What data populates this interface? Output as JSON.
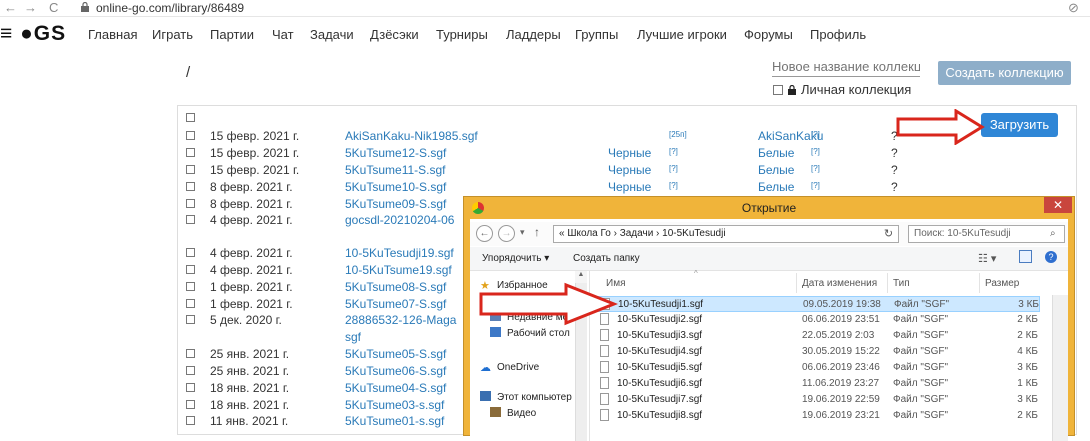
{
  "browser": {
    "back": "←",
    "forward": "→",
    "reload": "C",
    "url": "online-go.com/library/86489",
    "eye": "⊘"
  },
  "site": {
    "logo": "≡ ●GS",
    "nav": [
      "Главная",
      "Играть",
      "Партии",
      "Чат",
      "Задачи",
      "Дзёсэки",
      "Турниры",
      "Ладдеры",
      "Группы",
      "Лучшие игроки",
      "Форумы",
      "Профиль"
    ]
  },
  "library": {
    "path": "/",
    "new_collection_placeholder": "Новое название коллекции",
    "private_collection_label": "Личная коллекция",
    "create_collection_button": "Создать коллекцию",
    "upload_button": "Загрузить",
    "rows": [
      {
        "date": "15 февр. 2021 г.",
        "file": "AkiSanKaku-Nik1985.sgf",
        "black": "",
        "q1": "[25п]",
        "white": "AkiSanKaku",
        "q2": "[?]",
        "result": "?"
      },
      {
        "date": "15 февр. 2021 г.",
        "file": "5KuTsume12-S.sgf",
        "black": "Черные",
        "q1": "[?]",
        "white": "Белые",
        "q2": "[?]",
        "result": "?"
      },
      {
        "date": "15 февр. 2021 г.",
        "file": "5KuTsume11-S.sgf",
        "black": "Черные",
        "q1": "[?]",
        "white": "Белые",
        "q2": "[?]",
        "result": "?"
      },
      {
        "date": "8 февр. 2021 г.",
        "file": "5KuTsume10-S.sgf",
        "black": "Черные",
        "q1": "[?]",
        "white": "Белые",
        "q2": "[?]",
        "result": "?"
      },
      {
        "date": "8 февр. 2021 г.",
        "file": "5KuTsume09-S.sgf",
        "black": "",
        "q1": "",
        "white": "",
        "q2": "",
        "result": ""
      },
      {
        "date": "4 февр. 2021 г.",
        "file": "gocsdl-20210204-06",
        "black": "",
        "q1": "",
        "white": "",
        "q2": "",
        "result": ""
      },
      {
        "date": "4 февр. 2021 г.",
        "file": "10-5KuTesudji19.sgf",
        "black": "",
        "q1": "",
        "white": "",
        "q2": "",
        "result": ""
      },
      {
        "date": "4 февр. 2021 г.",
        "file": "10-5KuTsume19.sgf",
        "black": "",
        "q1": "",
        "white": "",
        "q2": "",
        "result": ""
      },
      {
        "date": "1 февр. 2021 г.",
        "file": "5KuTsume08-S.sgf",
        "black": "",
        "q1": "",
        "white": "",
        "q2": "",
        "result": ""
      },
      {
        "date": "1 февр. 2021 г.",
        "file": "5KuTsume07-S.sgf",
        "black": "",
        "q1": "",
        "white": "",
        "q2": "",
        "result": ""
      },
      {
        "date": "5 дек. 2020 г.",
        "file": "28886532-126-Maga",
        "black": "",
        "q1": "",
        "white": "",
        "q2": "",
        "result": ""
      },
      {
        "date": "",
        "file": "sgf",
        "black": "",
        "q1": "",
        "white": "",
        "q2": "",
        "result": ""
      },
      {
        "date": "25 янв. 2021 г.",
        "file": "5KuTsume05-S.sgf",
        "black": "",
        "q1": "",
        "white": "",
        "q2": "",
        "result": ""
      },
      {
        "date": "25 янв. 2021 г.",
        "file": "5KuTsume06-S.sgf",
        "black": "",
        "q1": "",
        "white": "",
        "q2": "",
        "result": ""
      },
      {
        "date": "18 янв. 2021 г.",
        "file": "5KuTsume04-S.sgf",
        "black": "",
        "q1": "",
        "white": "",
        "q2": "",
        "result": ""
      },
      {
        "date": "18 янв. 2021 г.",
        "file": "5KuTsume03-s.sgf",
        "black": "",
        "q1": "",
        "white": "",
        "q2": "",
        "result": ""
      },
      {
        "date": "11 янв. 2021 г.",
        "file": "5KuTsume01-s.sgf",
        "black": "",
        "q1": "",
        "white": "",
        "q2": "",
        "result": ""
      }
    ]
  },
  "dialog": {
    "title": "Открытие",
    "close": "✕",
    "path": "« Школа Го › Задачи › 10-5KuTesudji",
    "search_placeholder": "Поиск: 10-5KuTesudji",
    "organize": "Упорядочить ▾",
    "new_folder": "Создать папку",
    "sidebar": [
      "Избранное",
      "Недавние места",
      "Рабочий стол",
      "OneDrive",
      "Этот компьютер",
      "Видео"
    ],
    "columns": {
      "name": "Имя",
      "date": "Дата изменения",
      "type": "Тип",
      "size": "Размер"
    },
    "files": [
      {
        "name": "10-5KuTesudji1.sgf",
        "date": "09.05.2019 19:38",
        "type": "Файл \"SGF\"",
        "size": "3 КБ"
      },
      {
        "name": "10-5KuTesudji2.sgf",
        "date": "06.06.2019 23:51",
        "type": "Файл \"SGF\"",
        "size": "2 КБ"
      },
      {
        "name": "10-5KuTesudji3.sgf",
        "date": "22.05.2019 2:03",
        "type": "Файл \"SGF\"",
        "size": "2 КБ"
      },
      {
        "name": "10-5KuTesudji4.sgf",
        "date": "30.05.2019 15:22",
        "type": "Файл \"SGF\"",
        "size": "4 КБ"
      },
      {
        "name": "10-5KuTesudji5.sgf",
        "date": "06.06.2019 23:46",
        "type": "Файл \"SGF\"",
        "size": "3 КБ"
      },
      {
        "name": "10-5KuTesudji6.sgf",
        "date": "11.06.2019 23:27",
        "type": "Файл \"SGF\"",
        "size": "1 КБ"
      },
      {
        "name": "10-5KuTesudji7.sgf",
        "date": "19.06.2019 22:59",
        "type": "Файл \"SGF\"",
        "size": "3 КБ"
      },
      {
        "name": "10-5KuTesudji8.sgf",
        "date": "19.06.2019 23:21",
        "type": "Файл \"SGF\"",
        "size": "2 КБ"
      }
    ]
  },
  "colors": {
    "accent": "#2f86d6",
    "dialog_frame": "#f0b43a",
    "arrow": "#d9261c",
    "link": "#2a7ab8"
  }
}
